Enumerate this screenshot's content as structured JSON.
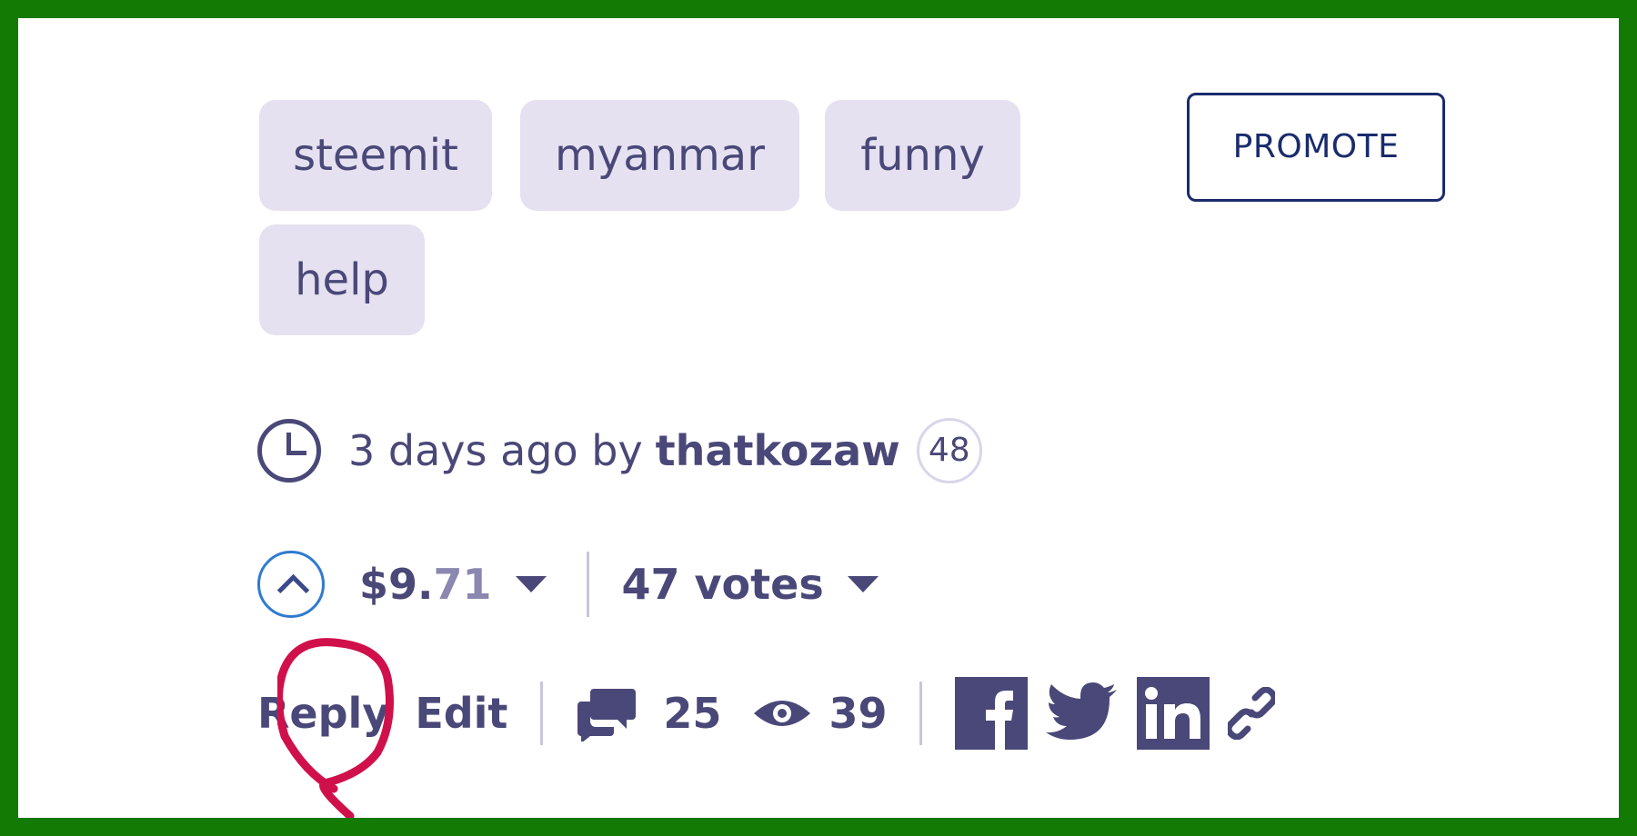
{
  "tags": [
    "steemit",
    "myanmar",
    "funny",
    "help"
  ],
  "promote_label": "PROMOTE",
  "meta": {
    "time_text": "3 days ago by",
    "author": "thatkozaw",
    "reputation": "48"
  },
  "vote": {
    "payout_dollars": "$9.",
    "payout_cents": "71",
    "votes_label": "47 votes"
  },
  "actions": {
    "reply_label": "Reply",
    "edit_label": "Edit",
    "comment_count": "25",
    "view_count": "39"
  },
  "icons": {
    "clock": "clock-icon",
    "upvote": "upvote-icon",
    "comments": "comments-icon",
    "views": "eye-icon",
    "facebook": "facebook-icon",
    "twitter": "twitter-icon",
    "linkedin": "linkedin-icon",
    "link": "link-icon"
  },
  "colors": {
    "frame": "#137a04",
    "tag_bg": "#e5e1f1",
    "text": "#4a4878",
    "promote_border": "#1a2b6d",
    "upvote_ring": "#2f7ad0",
    "annotation": "#d0104a"
  }
}
